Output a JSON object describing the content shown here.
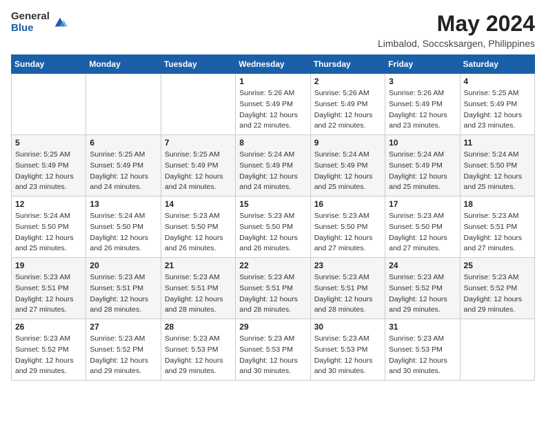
{
  "header": {
    "logo_general": "General",
    "logo_blue": "Blue",
    "title": "May 2024",
    "subtitle": "Limbalod, Soccsksargen, Philippines"
  },
  "days_of_week": [
    "Sunday",
    "Monday",
    "Tuesday",
    "Wednesday",
    "Thursday",
    "Friday",
    "Saturday"
  ],
  "weeks": [
    {
      "days": [
        {
          "num": "",
          "info": ""
        },
        {
          "num": "",
          "info": ""
        },
        {
          "num": "",
          "info": ""
        },
        {
          "num": "1",
          "info": "Sunrise: 5:26 AM\nSunset: 5:49 PM\nDaylight: 12 hours\nand 22 minutes."
        },
        {
          "num": "2",
          "info": "Sunrise: 5:26 AM\nSunset: 5:49 PM\nDaylight: 12 hours\nand 22 minutes."
        },
        {
          "num": "3",
          "info": "Sunrise: 5:26 AM\nSunset: 5:49 PM\nDaylight: 12 hours\nand 23 minutes."
        },
        {
          "num": "4",
          "info": "Sunrise: 5:25 AM\nSunset: 5:49 PM\nDaylight: 12 hours\nand 23 minutes."
        }
      ]
    },
    {
      "days": [
        {
          "num": "5",
          "info": "Sunrise: 5:25 AM\nSunset: 5:49 PM\nDaylight: 12 hours\nand 23 minutes."
        },
        {
          "num": "6",
          "info": "Sunrise: 5:25 AM\nSunset: 5:49 PM\nDaylight: 12 hours\nand 24 minutes."
        },
        {
          "num": "7",
          "info": "Sunrise: 5:25 AM\nSunset: 5:49 PM\nDaylight: 12 hours\nand 24 minutes."
        },
        {
          "num": "8",
          "info": "Sunrise: 5:24 AM\nSunset: 5:49 PM\nDaylight: 12 hours\nand 24 minutes."
        },
        {
          "num": "9",
          "info": "Sunrise: 5:24 AM\nSunset: 5:49 PM\nDaylight: 12 hours\nand 25 minutes."
        },
        {
          "num": "10",
          "info": "Sunrise: 5:24 AM\nSunset: 5:49 PM\nDaylight: 12 hours\nand 25 minutes."
        },
        {
          "num": "11",
          "info": "Sunrise: 5:24 AM\nSunset: 5:50 PM\nDaylight: 12 hours\nand 25 minutes."
        }
      ]
    },
    {
      "days": [
        {
          "num": "12",
          "info": "Sunrise: 5:24 AM\nSunset: 5:50 PM\nDaylight: 12 hours\nand 25 minutes."
        },
        {
          "num": "13",
          "info": "Sunrise: 5:24 AM\nSunset: 5:50 PM\nDaylight: 12 hours\nand 26 minutes."
        },
        {
          "num": "14",
          "info": "Sunrise: 5:23 AM\nSunset: 5:50 PM\nDaylight: 12 hours\nand 26 minutes."
        },
        {
          "num": "15",
          "info": "Sunrise: 5:23 AM\nSunset: 5:50 PM\nDaylight: 12 hours\nand 26 minutes."
        },
        {
          "num": "16",
          "info": "Sunrise: 5:23 AM\nSunset: 5:50 PM\nDaylight: 12 hours\nand 27 minutes."
        },
        {
          "num": "17",
          "info": "Sunrise: 5:23 AM\nSunset: 5:50 PM\nDaylight: 12 hours\nand 27 minutes."
        },
        {
          "num": "18",
          "info": "Sunrise: 5:23 AM\nSunset: 5:51 PM\nDaylight: 12 hours\nand 27 minutes."
        }
      ]
    },
    {
      "days": [
        {
          "num": "19",
          "info": "Sunrise: 5:23 AM\nSunset: 5:51 PM\nDaylight: 12 hours\nand 27 minutes."
        },
        {
          "num": "20",
          "info": "Sunrise: 5:23 AM\nSunset: 5:51 PM\nDaylight: 12 hours\nand 28 minutes."
        },
        {
          "num": "21",
          "info": "Sunrise: 5:23 AM\nSunset: 5:51 PM\nDaylight: 12 hours\nand 28 minutes."
        },
        {
          "num": "22",
          "info": "Sunrise: 5:23 AM\nSunset: 5:51 PM\nDaylight: 12 hours\nand 28 minutes."
        },
        {
          "num": "23",
          "info": "Sunrise: 5:23 AM\nSunset: 5:51 PM\nDaylight: 12 hours\nand 28 minutes."
        },
        {
          "num": "24",
          "info": "Sunrise: 5:23 AM\nSunset: 5:52 PM\nDaylight: 12 hours\nand 29 minutes."
        },
        {
          "num": "25",
          "info": "Sunrise: 5:23 AM\nSunset: 5:52 PM\nDaylight: 12 hours\nand 29 minutes."
        }
      ]
    },
    {
      "days": [
        {
          "num": "26",
          "info": "Sunrise: 5:23 AM\nSunset: 5:52 PM\nDaylight: 12 hours\nand 29 minutes."
        },
        {
          "num": "27",
          "info": "Sunrise: 5:23 AM\nSunset: 5:52 PM\nDaylight: 12 hours\nand 29 minutes."
        },
        {
          "num": "28",
          "info": "Sunrise: 5:23 AM\nSunset: 5:53 PM\nDaylight: 12 hours\nand 29 minutes."
        },
        {
          "num": "29",
          "info": "Sunrise: 5:23 AM\nSunset: 5:53 PM\nDaylight: 12 hours\nand 30 minutes."
        },
        {
          "num": "30",
          "info": "Sunrise: 5:23 AM\nSunset: 5:53 PM\nDaylight: 12 hours\nand 30 minutes."
        },
        {
          "num": "31",
          "info": "Sunrise: 5:23 AM\nSunset: 5:53 PM\nDaylight: 12 hours\nand 30 minutes."
        },
        {
          "num": "",
          "info": ""
        }
      ]
    }
  ]
}
